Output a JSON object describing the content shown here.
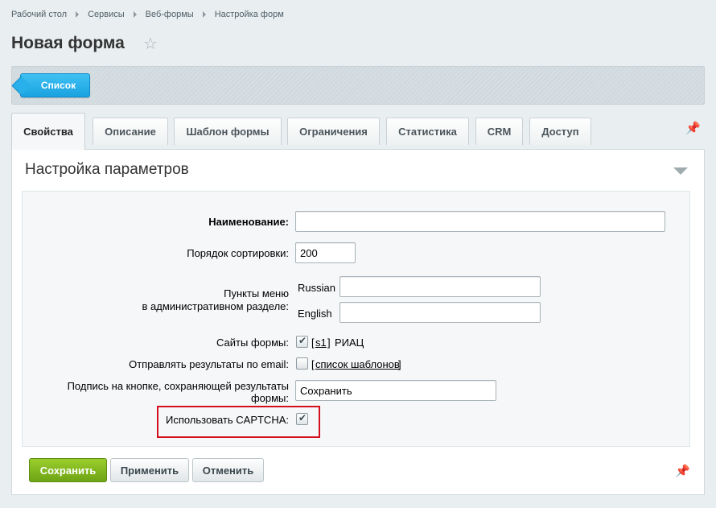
{
  "breadcrumb": [
    "Рабочий стол",
    "Сервисы",
    "Веб-формы",
    "Настройка форм"
  ],
  "page": {
    "title": "Новая форма"
  },
  "toolbar": {
    "list_label": "Список"
  },
  "tabs": [
    {
      "label": "Свойства",
      "active": true
    },
    {
      "label": "Описание",
      "active": false
    },
    {
      "label": "Шаблон формы",
      "active": false
    },
    {
      "label": "Ограничения",
      "active": false
    },
    {
      "label": "Статистика",
      "active": false
    },
    {
      "label": "CRM",
      "active": false
    },
    {
      "label": "Доступ",
      "active": false
    }
  ],
  "panel": {
    "title": "Настройка параметров",
    "fields": {
      "name_label": "Наименование:",
      "name_value": "",
      "sort_label": "Порядок сортировки:",
      "sort_value": "200",
      "menu_label_line1": "Пункты меню",
      "menu_label_line2": "в административном разделе:",
      "lang_russian": "Russian",
      "lang_english": "English",
      "russian_value": "",
      "english_value": "",
      "sites_label": "Сайты формы:",
      "sites_checked": true,
      "site_open": "[",
      "site_id": "s1",
      "site_close": "]",
      "site_name": "РИАЦ",
      "email_label": "Отправлять результаты по email:",
      "email_checked": false,
      "templates_open": "[",
      "templates_link": "список шаблонов",
      "templates_close": "]",
      "button_caption_label_line1": "Подпись на кнопке, сохраняющей результаты",
      "button_caption_label_line2": "формы:",
      "button_caption_value": "Сохранить",
      "captcha_label": "Использовать CAPTCHA:",
      "captcha_checked": true
    }
  },
  "buttons": {
    "save": "Сохранить",
    "apply": "Применить",
    "cancel": "Отменить"
  },
  "colors": {
    "accent_blue": "#1aa2e0",
    "save_green": "#6ea315",
    "highlight_red": "#d4101f"
  }
}
